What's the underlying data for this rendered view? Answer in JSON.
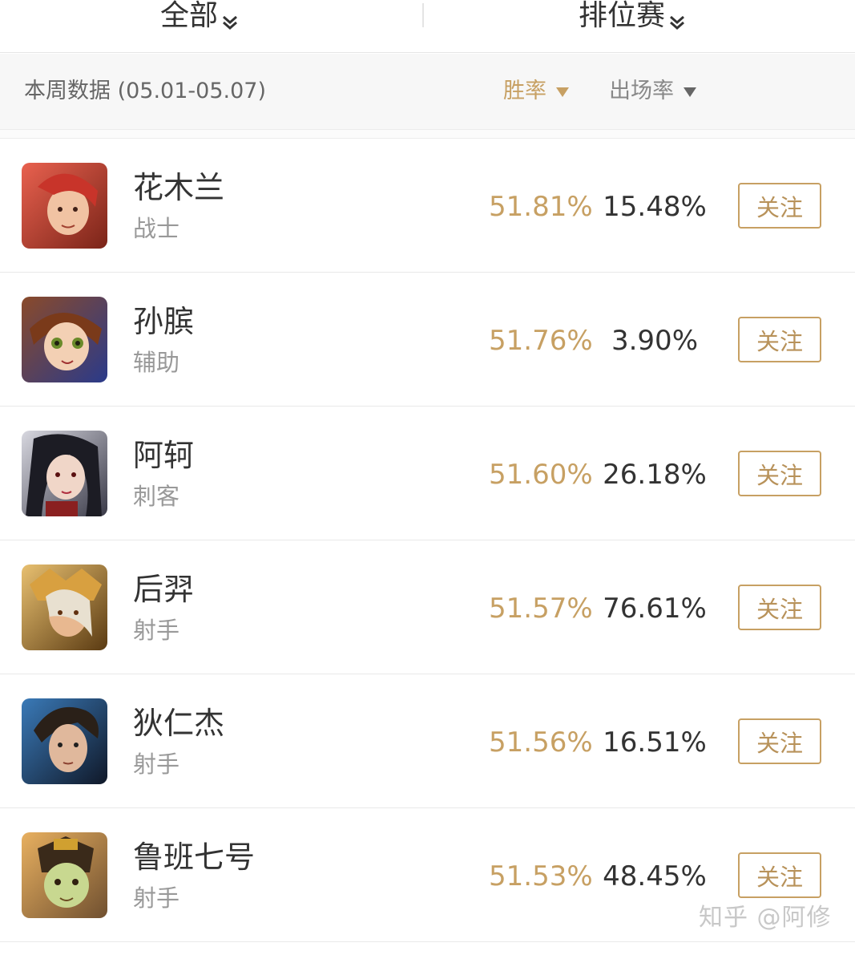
{
  "filters": {
    "scope_label": "全部",
    "mode_label": "排位赛"
  },
  "subheader": {
    "week_label": "本周数据 (05.01-05.07)",
    "sort_win_label": "胜率",
    "sort_pick_label": "出场率"
  },
  "colors": {
    "accent": "#c7a063",
    "text": "#333333",
    "muted": "#999999"
  },
  "heroes": [
    {
      "name": "花木兰",
      "role": "战士",
      "win_rate": "51.81%",
      "pick_rate": "15.48%",
      "follow_label": "关注",
      "avatar_icon": "hero-portrait-icon"
    },
    {
      "name": "孙膑",
      "role": "辅助",
      "win_rate": "51.76%",
      "pick_rate": "3.90%",
      "follow_label": "关注",
      "avatar_icon": "hero-portrait-icon"
    },
    {
      "name": "阿轲",
      "role": "刺客",
      "win_rate": "51.60%",
      "pick_rate": "26.18%",
      "follow_label": "关注",
      "avatar_icon": "hero-portrait-icon"
    },
    {
      "name": "后羿",
      "role": "射手",
      "win_rate": "51.57%",
      "pick_rate": "76.61%",
      "follow_label": "关注",
      "avatar_icon": "hero-portrait-icon"
    },
    {
      "name": "狄仁杰",
      "role": "射手",
      "win_rate": "51.56%",
      "pick_rate": "16.51%",
      "follow_label": "关注",
      "avatar_icon": "hero-portrait-icon"
    },
    {
      "name": "鲁班七号",
      "role": "射手",
      "win_rate": "51.53%",
      "pick_rate": "48.45%",
      "follow_label": "关注",
      "avatar_icon": "hero-portrait-icon"
    }
  ],
  "watermark": "知乎 @阿修"
}
